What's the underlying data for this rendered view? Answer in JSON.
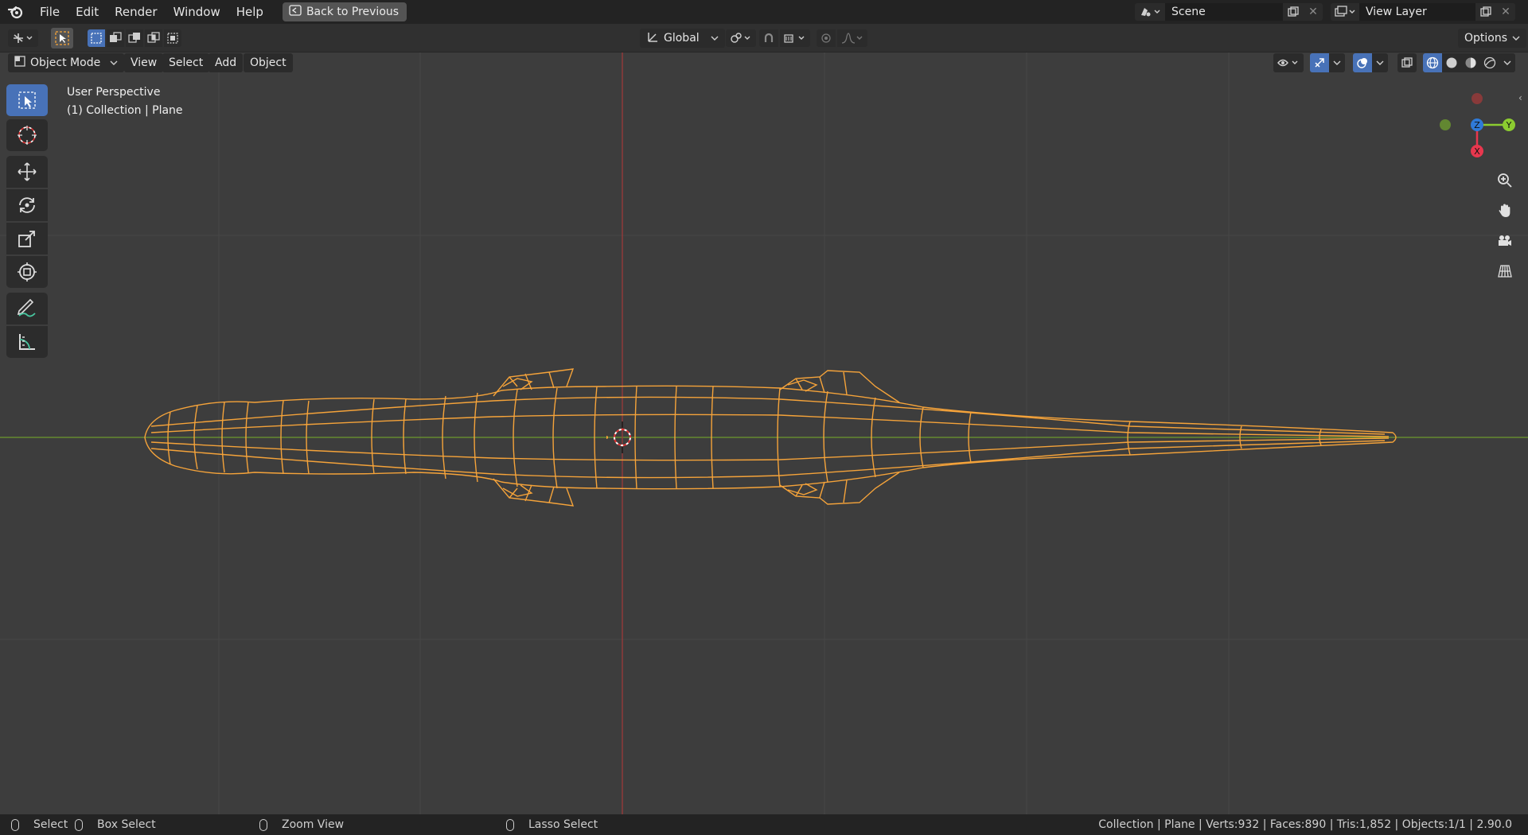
{
  "menu": {
    "file": "File",
    "edit": "Edit",
    "render": "Render",
    "window": "Window",
    "help": "Help",
    "back_to_previous": "Back to Previous"
  },
  "scene": {
    "name": "Scene"
  },
  "view_layer": {
    "name": "View Layer"
  },
  "toolbar": {
    "transform_orientation": "Global",
    "options": "Options"
  },
  "viewport_header": {
    "mode": "Object Mode",
    "view": "View",
    "select": "Select",
    "add": "Add",
    "object": "Object"
  },
  "viewport_info": {
    "perspective": "User Perspective",
    "collection": "(1) Collection | Plane"
  },
  "gizmo": {
    "z": "Z",
    "y": "Y",
    "x": "X"
  },
  "statusbar": {
    "select": "Select",
    "box_select": "Box Select",
    "zoom_view": "Zoom View",
    "lasso_select": "Lasso Select",
    "stats": "Collection | Plane | Verts:932 | Faces:890 | Tris:1,852 | Objects:1/1 | 2.90.0"
  },
  "colors": {
    "accent": "#4872b8",
    "wire": "#f5a33a",
    "x_axis": "#9b3a3a",
    "y_axis": "#6c9a2e"
  }
}
